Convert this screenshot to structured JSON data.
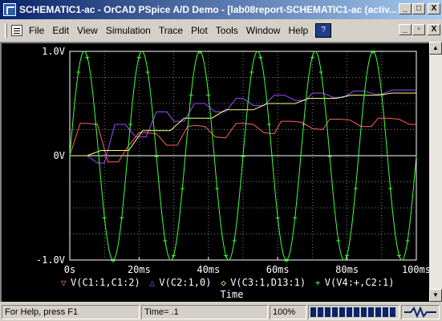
{
  "window": {
    "title": "SCHEMATIC1-ac - OrCAD PSpice A/D Demo - [lab08report-SCHEMATIC1-ac (activ...",
    "minimize_glyph": "_",
    "maximize_glyph": "□",
    "close_glyph": "X"
  },
  "menu": {
    "items": [
      "File",
      "Edit",
      "View",
      "Simulation",
      "Trace",
      "Plot",
      "Tools",
      "Window",
      "Help"
    ],
    "child_min_glyph": "_",
    "child_restore_glyph": "▫",
    "child_close_glyph": "X"
  },
  "plot": {
    "background": "#000000",
    "axis_color": "#ffffff",
    "grid_color": "#808080",
    "y_tick_labels": [
      "1.0V",
      "0V",
      "-1.0V"
    ],
    "x_tick_labels": [
      "0s",
      "20ms",
      "40ms",
      "60ms",
      "80ms",
      "100ms"
    ],
    "xlabel": "Time",
    "legend": [
      {
        "marker": "▽",
        "label": "V(C1:1,C1:2)",
        "color": "#ff6060"
      },
      {
        "marker": "△",
        "label": "V(C2:1,0)",
        "color": "#9a4cff"
      },
      {
        "marker": "◇",
        "label": "V(C3:1,D13:1)",
        "color": "#ffff80"
      },
      {
        "marker": "+",
        "label": "V(V4:+,C2:1)",
        "color": "#40ff40"
      }
    ]
  },
  "chart_data": {
    "type": "line",
    "xlabel": "Time",
    "ylabel": "",
    "xlim": [
      0,
      0.1
    ],
    "ylim": [
      -1.0,
      1.0
    ],
    "x_ticks": [
      0,
      0.02,
      0.04,
      0.06,
      0.08,
      0.1
    ],
    "y_ticks": [
      -1.0,
      0,
      1.0
    ],
    "grid": true,
    "series": [
      {
        "name": "V(V4:+,C2:1)",
        "color": "#40ff40",
        "function": "sine",
        "amplitude": 1.0,
        "frequency_hz": 60,
        "phase_deg": 0
      },
      {
        "name": "V(C1:1,C1:2)",
        "color": "#ff6060",
        "x": [
          0,
          0.003,
          0.005,
          0.008,
          0.011,
          0.014,
          0.017,
          0.02,
          0.022,
          0.025,
          0.028,
          0.031,
          0.034,
          0.036,
          0.039,
          0.042,
          0.045,
          0.048,
          0.05,
          0.053,
          0.056,
          0.059,
          0.061,
          0.064,
          0.067,
          0.07,
          0.073,
          0.075,
          0.078,
          0.081,
          0.084,
          0.087,
          0.089,
          0.092,
          0.095,
          0.098,
          0.1
        ],
        "y": [
          0.0,
          0.31,
          0.31,
          0.3,
          -0.06,
          -0.06,
          0.1,
          0.22,
          0.22,
          0.21,
          0.1,
          0.1,
          0.28,
          0.29,
          0.28,
          0.18,
          0.17,
          0.31,
          0.31,
          0.3,
          0.22,
          0.21,
          0.33,
          0.33,
          0.32,
          0.26,
          0.25,
          0.35,
          0.35,
          0.34,
          0.28,
          0.28,
          0.36,
          0.36,
          0.35,
          0.3,
          0.3
        ]
      },
      {
        "name": "V(C2:1,0)",
        "color": "#9a4cff",
        "x": [
          0,
          0.005,
          0.008,
          0.01,
          0.013,
          0.016,
          0.019,
          0.022,
          0.025,
          0.028,
          0.03,
          0.033,
          0.036,
          0.039,
          0.042,
          0.045,
          0.048,
          0.05,
          0.053,
          0.056,
          0.059,
          0.062,
          0.065,
          0.068,
          0.07,
          0.073,
          0.076,
          0.079,
          0.082,
          0.085,
          0.088,
          0.09,
          0.093,
          0.096,
          0.1
        ],
        "y": [
          0.0,
          0.0,
          -0.07,
          -0.07,
          0.3,
          0.3,
          0.18,
          0.18,
          0.42,
          0.42,
          0.33,
          0.33,
          0.5,
          0.5,
          0.42,
          0.42,
          0.55,
          0.55,
          0.48,
          0.48,
          0.58,
          0.58,
          0.53,
          0.53,
          0.6,
          0.6,
          0.56,
          0.56,
          0.62,
          0.62,
          0.59,
          0.59,
          0.63,
          0.63,
          0.63
        ]
      },
      {
        "name": "V(C3:1,D13:1)",
        "color": "#ffff80",
        "x": [
          0,
          0.005,
          0.009,
          0.013,
          0.017,
          0.021,
          0.025,
          0.029,
          0.033,
          0.037,
          0.041,
          0.045,
          0.049,
          0.053,
          0.057,
          0.061,
          0.065,
          0.069,
          0.073,
          0.077,
          0.081,
          0.085,
          0.089,
          0.093,
          0.097,
          0.1
        ],
        "y": [
          0.0,
          0.0,
          0.05,
          0.05,
          0.05,
          0.24,
          0.24,
          0.24,
          0.36,
          0.36,
          0.36,
          0.44,
          0.44,
          0.44,
          0.5,
          0.5,
          0.5,
          0.55,
          0.55,
          0.55,
          0.58,
          0.58,
          0.58,
          0.6,
          0.6,
          0.6
        ]
      }
    ]
  },
  "statusbar": {
    "help_text": "For Help, press F1",
    "time_text": "Time= .1",
    "zoom_text": "100%",
    "progress_fraction": 1.0
  }
}
